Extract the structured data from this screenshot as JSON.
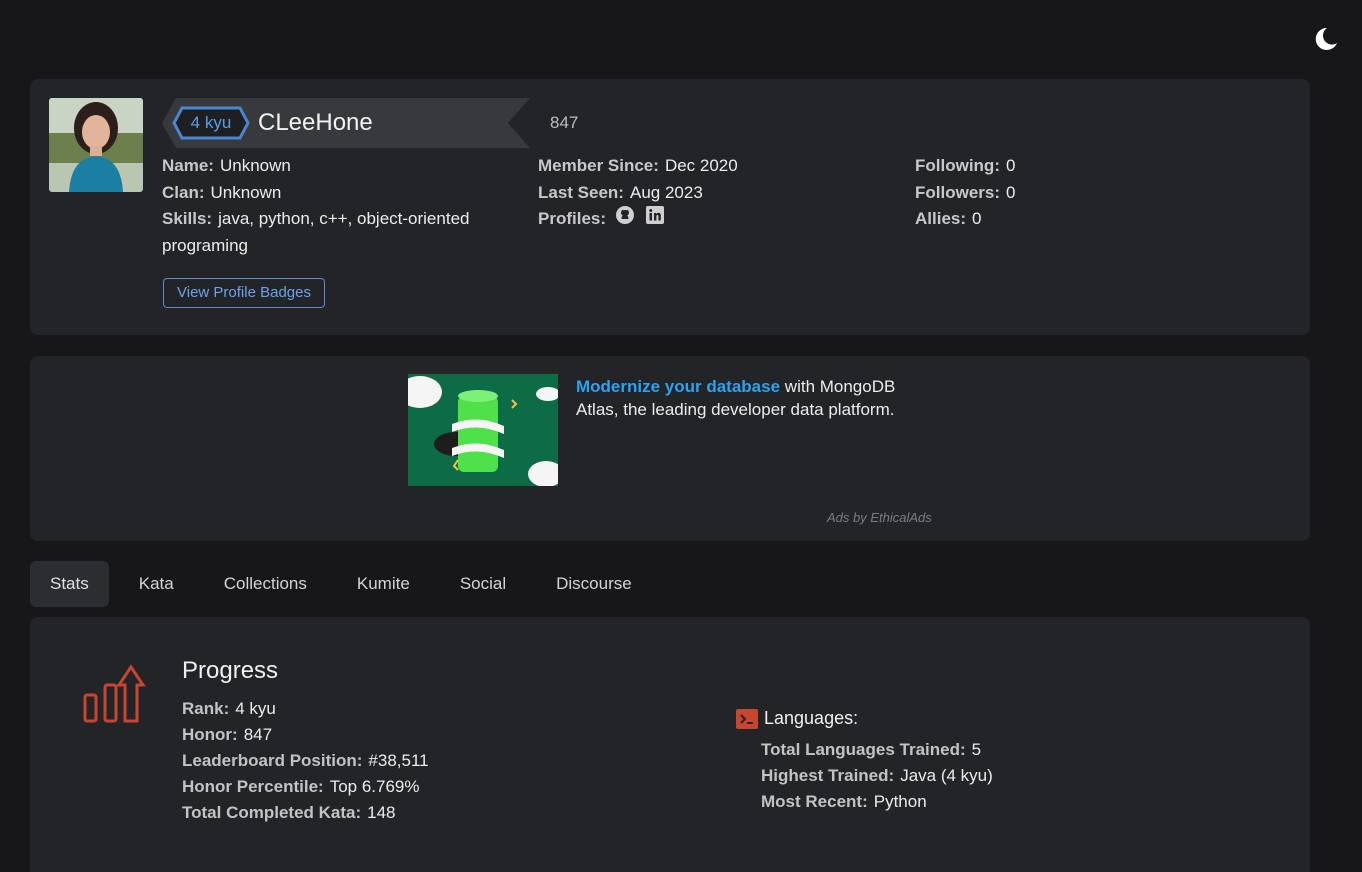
{
  "profile": {
    "rank": "4 kyu",
    "username": "CLeeHone",
    "honor": "847",
    "name_label": "Name:",
    "name_value": "Unknown",
    "clan_label": "Clan:",
    "clan_value": "Unknown",
    "skills_label": "Skills:",
    "skills_value": "java, python, c++, object-oriented programing",
    "member_since_label": "Member Since:",
    "member_since_value": "Dec 2020",
    "last_seen_label": "Last Seen:",
    "last_seen_value": "Aug 2023",
    "profiles_label": "Profiles:",
    "profile_icons": [
      "github-icon",
      "linkedin-icon"
    ],
    "following_label": "Following:",
    "following_value": "0",
    "followers_label": "Followers:",
    "followers_value": "0",
    "allies_label": "Allies:",
    "allies_value": "0",
    "badges_button": "View Profile Badges"
  },
  "ad": {
    "link_text": "Modernize your database",
    "body_text": " with MongoDB Atlas, the leading developer data platform.",
    "credit": "Ads by EthicalAds"
  },
  "tabs": [
    {
      "label": "Stats",
      "active": true
    },
    {
      "label": "Kata",
      "active": false
    },
    {
      "label": "Collections",
      "active": false
    },
    {
      "label": "Kumite",
      "active": false
    },
    {
      "label": "Social",
      "active": false
    },
    {
      "label": "Discourse",
      "active": false
    }
  ],
  "progress": {
    "title": "Progress",
    "items": [
      {
        "label": "Rank:",
        "value": "4 kyu"
      },
      {
        "label": "Honor:",
        "value": "847"
      },
      {
        "label": "Leaderboard Position:",
        "value": "#38,511"
      },
      {
        "label": "Honor Percentile:",
        "value": "Top 6.769%"
      },
      {
        "label": "Total Completed Kata:",
        "value": "148"
      }
    ]
  },
  "languages": {
    "title": "Languages:",
    "items": [
      {
        "label": "Total Languages Trained:",
        "value": "5"
      },
      {
        "label": "Highest Trained:",
        "value": "Java (4 kyu)"
      },
      {
        "label": "Most Recent:",
        "value": "Python"
      }
    ]
  },
  "colors": {
    "background": "#171719",
    "card": "#232428",
    "rank_blue": "#4a86cf",
    "accent_red": "#c8452e",
    "link_blue": "#2aa3f0"
  }
}
